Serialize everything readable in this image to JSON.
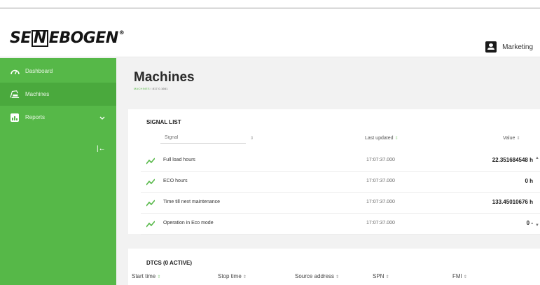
{
  "header": {
    "logo_text_left": "SE",
    "logo_text_n": "N",
    "logo_text_right": "EBOGEN",
    "logo_mark": "®",
    "user_name": "Marketing"
  },
  "sidebar": {
    "items": [
      {
        "label": "Dashboard",
        "icon": "gauge-icon"
      },
      {
        "label": "Machines",
        "icon": "machine-icon"
      },
      {
        "label": "Reports",
        "icon": "reports-icon"
      }
    ],
    "collapse_glyph": "|←"
  },
  "page": {
    "title": "Machines",
    "breadcrumb_root": "MACHINES",
    "breadcrumb_sep": " / ",
    "breadcrumb_current": "817.0.1661"
  },
  "signal_list": {
    "title": "SIGNAL LIST",
    "search_placeholder": "Signal",
    "col_last_updated": "Last updated",
    "col_value": "Value",
    "rows": [
      {
        "name": "Full load hours",
        "time": "17:07:37.000",
        "value": "22.351684548 h"
      },
      {
        "name": "ECO hours",
        "time": "17:07:37.000",
        "value": "0 h"
      },
      {
        "name": "Time till next maintenance",
        "time": "17:07:37.000",
        "value": "133.45010676 h"
      },
      {
        "name": "Operation in Eco mode",
        "time": "17:07:37.000",
        "value": "0 -"
      }
    ]
  },
  "dtcs": {
    "title": "DTCS (0 ACTIVE)",
    "columns": [
      "Start time",
      "Stop time",
      "Source address",
      "SPN",
      "FMI"
    ]
  },
  "colors": {
    "brand_green": "#56b848"
  }
}
